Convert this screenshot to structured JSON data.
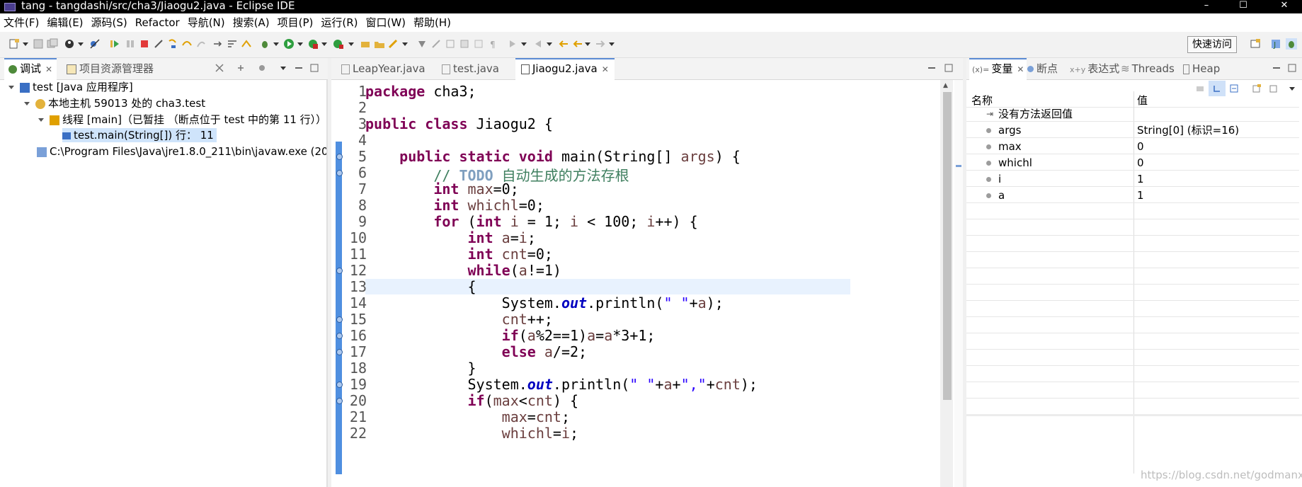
{
  "window": {
    "title": "tang - tangdashi/src/cha3/Jiaogu2.java - Eclipse IDE",
    "minimize": "–",
    "maximize": "☐",
    "close": "✕"
  },
  "menu": [
    "文件(F)",
    "编辑(E)",
    "源码(S)",
    "Refactor",
    "导航(N)",
    "搜索(A)",
    "项目(P)",
    "运行(R)",
    "窗口(W)",
    "帮助(H)"
  ],
  "toolbar": {
    "quick_access": "快速访问"
  },
  "debug_view": {
    "tabs": [
      {
        "label": "调试",
        "close": "✕"
      },
      {
        "label": "项目资源管理器"
      }
    ],
    "tree": [
      {
        "label": "test [Java 应用程序]"
      },
      {
        "label": "本地主机 59013 处的 cha3.test"
      },
      {
        "label": "线程 [main]（已暂挂 （断点位于 test 中的第 11 行））"
      },
      {
        "label": "test.main(String[]) 行：  11"
      },
      {
        "label": "C:\\Program Files\\Java\\jre1.8.0_211\\bin\\javaw.exe  (20"
      }
    ]
  },
  "editor": {
    "tabs": [
      {
        "label": "LeapYear.java"
      },
      {
        "label": "test.java"
      },
      {
        "label": "Jiaogu2.java",
        "close": "✕"
      }
    ],
    "line_numbers": [
      "1",
      "2",
      "3",
      "4",
      "5",
      "6",
      "7",
      "8",
      "9",
      "10",
      "11",
      "12",
      "13",
      "14",
      "15",
      "16",
      "17",
      "18",
      "19",
      "20",
      "21",
      "22"
    ],
    "lines": [
      {
        "indent": "",
        "segs": [
          {
            "c": "kw",
            "t": "package"
          },
          {
            "c": "",
            "t": " cha3;"
          }
        ]
      },
      {
        "indent": "",
        "segs": []
      },
      {
        "indent": "",
        "segs": [
          {
            "c": "kw",
            "t": "public class"
          },
          {
            "c": "",
            "t": " Jiaogu2 {"
          }
        ]
      },
      {
        "indent": "",
        "segs": []
      },
      {
        "indent": "    ",
        "segs": [
          {
            "c": "kw",
            "t": "public static void"
          },
          {
            "c": "",
            "t": " main(String[] "
          },
          {
            "c": "var",
            "t": "args"
          },
          {
            "c": "",
            "t": ") {"
          }
        ]
      },
      {
        "indent": "        ",
        "segs": [
          {
            "c": "cm",
            "t": "// "
          },
          {
            "c": "todo",
            "t": "TODO"
          },
          {
            "c": "cm",
            "t": " 自动生成的方法存根"
          }
        ]
      },
      {
        "indent": "        ",
        "segs": [
          {
            "c": "kw",
            "t": "int"
          },
          {
            "c": "",
            "t": " "
          },
          {
            "c": "var",
            "t": "max"
          },
          {
            "c": "",
            "t": "=0;"
          }
        ]
      },
      {
        "indent": "        ",
        "segs": [
          {
            "c": "kw",
            "t": "int"
          },
          {
            "c": "",
            "t": " "
          },
          {
            "c": "var",
            "t": "whichl"
          },
          {
            "c": "",
            "t": "=0;"
          }
        ]
      },
      {
        "indent": "        ",
        "segs": [
          {
            "c": "kw",
            "t": "for"
          },
          {
            "c": "",
            "t": " ("
          },
          {
            "c": "kw",
            "t": "int"
          },
          {
            "c": "",
            "t": " "
          },
          {
            "c": "var",
            "t": "i"
          },
          {
            "c": "",
            "t": " = 1; "
          },
          {
            "c": "var",
            "t": "i"
          },
          {
            "c": "",
            "t": " < 100; "
          },
          {
            "c": "var",
            "t": "i"
          },
          {
            "c": "",
            "t": "++) {"
          }
        ]
      },
      {
        "indent": "            ",
        "segs": [
          {
            "c": "kw",
            "t": "int"
          },
          {
            "c": "",
            "t": " "
          },
          {
            "c": "var",
            "t": "a"
          },
          {
            "c": "",
            "t": "="
          },
          {
            "c": "var",
            "t": "i"
          },
          {
            "c": "",
            "t": ";"
          }
        ]
      },
      {
        "indent": "            ",
        "segs": [
          {
            "c": "kw",
            "t": "int"
          },
          {
            "c": "",
            "t": " "
          },
          {
            "c": "var",
            "t": "cnt"
          },
          {
            "c": "",
            "t": "=0;"
          }
        ]
      },
      {
        "indent": "            ",
        "segs": [
          {
            "c": "kw",
            "t": "while"
          },
          {
            "c": "",
            "t": "("
          },
          {
            "c": "var",
            "t": "a"
          },
          {
            "c": "",
            "t": "!=1)"
          }
        ]
      },
      {
        "indent": "            ",
        "segs": [
          {
            "c": "",
            "t": "{"
          }
        ]
      },
      {
        "indent": "                ",
        "segs": [
          {
            "c": "",
            "t": "System."
          },
          {
            "c": "fld",
            "t": "out"
          },
          {
            "c": "",
            "t": ".println("
          },
          {
            "c": "str",
            "t": "\" \""
          },
          {
            "c": "",
            "t": "+"
          },
          {
            "c": "var",
            "t": "a"
          },
          {
            "c": "",
            "t": ");"
          }
        ]
      },
      {
        "indent": "                ",
        "segs": [
          {
            "c": "var",
            "t": "cnt"
          },
          {
            "c": "",
            "t": "++;"
          }
        ]
      },
      {
        "indent": "                ",
        "segs": [
          {
            "c": "kw",
            "t": "if"
          },
          {
            "c": "",
            "t": "("
          },
          {
            "c": "var",
            "t": "a"
          },
          {
            "c": "",
            "t": "%2==1)"
          },
          {
            "c": "var",
            "t": "a"
          },
          {
            "c": "",
            "t": "="
          },
          {
            "c": "var",
            "t": "a"
          },
          {
            "c": "",
            "t": "*3+1;"
          }
        ]
      },
      {
        "indent": "                ",
        "segs": [
          {
            "c": "kw",
            "t": "else"
          },
          {
            "c": "",
            "t": " "
          },
          {
            "c": "var",
            "t": "a"
          },
          {
            "c": "",
            "t": "/=2;"
          }
        ]
      },
      {
        "indent": "            ",
        "segs": [
          {
            "c": "",
            "t": "}"
          }
        ]
      },
      {
        "indent": "            ",
        "segs": [
          {
            "c": "",
            "t": "System."
          },
          {
            "c": "fld",
            "t": "out"
          },
          {
            "c": "",
            "t": ".println("
          },
          {
            "c": "str",
            "t": "\" \""
          },
          {
            "c": "",
            "t": "+"
          },
          {
            "c": "var",
            "t": "a"
          },
          {
            "c": "",
            "t": "+"
          },
          {
            "c": "str",
            "t": "\",\""
          },
          {
            "c": "",
            "t": "+"
          },
          {
            "c": "var",
            "t": "cnt"
          },
          {
            "c": "",
            "t": ");"
          }
        ]
      },
      {
        "indent": "            ",
        "segs": [
          {
            "c": "kw",
            "t": "if"
          },
          {
            "c": "",
            "t": "("
          },
          {
            "c": "var",
            "t": "max"
          },
          {
            "c": "",
            "t": "<"
          },
          {
            "c": "var",
            "t": "cnt"
          },
          {
            "c": "",
            "t": ") {"
          }
        ]
      },
      {
        "indent": "                ",
        "segs": [
          {
            "c": "var",
            "t": "max"
          },
          {
            "c": "",
            "t": "="
          },
          {
            "c": "var",
            "t": "cnt"
          },
          {
            "c": "",
            "t": ";"
          }
        ]
      },
      {
        "indent": "                ",
        "segs": [
          {
            "c": "var",
            "t": "whichl"
          },
          {
            "c": "",
            "t": "="
          },
          {
            "c": "var",
            "t": "i"
          },
          {
            "c": "",
            "t": ";"
          }
        ]
      }
    ]
  },
  "variables_view": {
    "tabs": [
      {
        "label": "变量",
        "close": "✕"
      },
      {
        "label": "断点"
      },
      {
        "label": "表达式"
      },
      {
        "label": "Threads"
      },
      {
        "label": "Heap"
      }
    ],
    "columns": {
      "name": "名称",
      "value": "值"
    },
    "rows": [
      {
        "name": "没有方法返回值",
        "value": ""
      },
      {
        "name": "args",
        "value": "String[0]   (标识=16)"
      },
      {
        "name": "max",
        "value": "0"
      },
      {
        "name": "whichl",
        "value": "0"
      },
      {
        "name": "i",
        "value": "1"
      },
      {
        "name": "a",
        "value": "1"
      }
    ]
  },
  "watermark": "https://blog.csdn.net/godmanxh"
}
